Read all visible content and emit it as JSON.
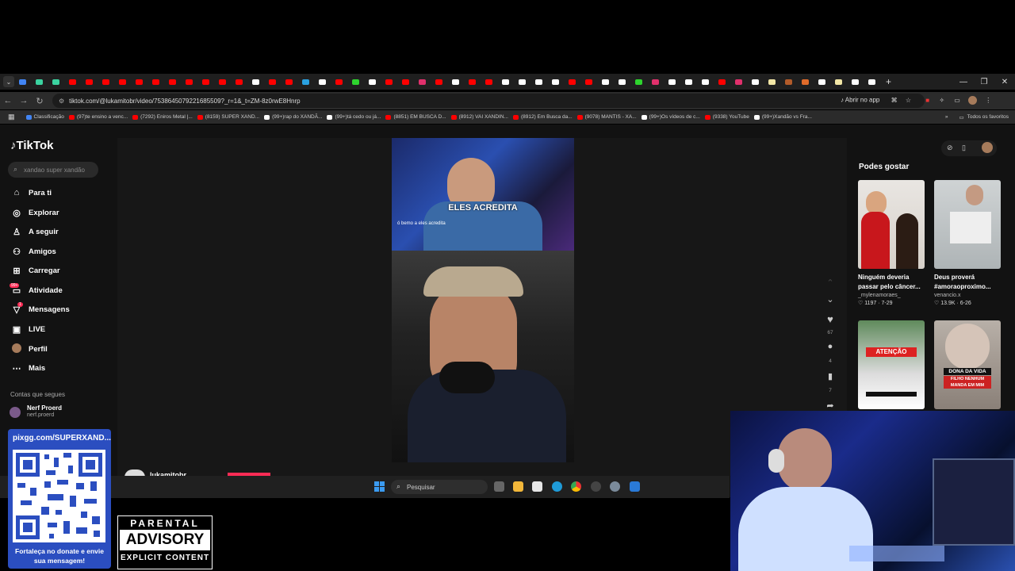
{
  "browser": {
    "url": "tiktok.com/@lukamitobr/video/7538645079221685509?_r=1&_t=ZM-8z0rwE8Hnrp",
    "open_app_label": "Abrir no app",
    "all_favorites_label": "Todos os favoritos",
    "bookmarks": [
      {
        "label": "Classificação",
        "color": "#4285f4"
      },
      {
        "label": "(97)te ensino a venc...",
        "color": "#ff0000"
      },
      {
        "label": "(7292) Eniros Metal |...",
        "color": "#ff0000"
      },
      {
        "label": "(8159) SUPER XAND...",
        "color": "#ff0000"
      },
      {
        "label": "(99+)rap do XANDÃ...",
        "color": "#ffffff"
      },
      {
        "label": "(99+)tá cedo ou já...",
        "color": "#ffffff"
      },
      {
        "label": "(8851) EM BUSCA D...",
        "color": "#ff0000"
      },
      {
        "label": "(8912) VAI XANDIN...",
        "color": "#ff0000"
      },
      {
        "label": "(8912) Em Busca da...",
        "color": "#ff0000"
      },
      {
        "label": "(9078) MANTIS - XA...",
        "color": "#ff0000"
      },
      {
        "label": "(99+)Os vídeos de c...",
        "color": "#ffffff"
      },
      {
        "label": "(9338) YouTube",
        "color": "#ff0000"
      },
      {
        "label": "(99+)Xandão vs Fra...",
        "color": "#ffffff"
      }
    ]
  },
  "tiktok": {
    "logo": "TikTok",
    "search_placeholder": "xandao super xandão",
    "nav": [
      {
        "label": "Para ti"
      },
      {
        "label": "Explorar"
      },
      {
        "label": "A seguir"
      },
      {
        "label": "Amigos"
      },
      {
        "label": "Carregar"
      },
      {
        "label": "Atividade"
      },
      {
        "label": "Mensagens"
      },
      {
        "label": "LIVE"
      },
      {
        "label": "Perfil"
      },
      {
        "label": "Mais"
      }
    ],
    "activity_badge": "99+",
    "messages_badge": "1",
    "following_heading": "Contas que segues",
    "following_account": {
      "name": "Nerf Proerd",
      "handle": "nerf.proerd"
    },
    "video": {
      "caption_big": "ELES ACREDITA",
      "caption_small": "ó bemo a eles acredita",
      "author": "lukamitobr"
    },
    "actions": {
      "likes": "67",
      "comments": "4",
      "saves": "7"
    },
    "suggestions_heading": "Podes gostar",
    "suggestions": [
      {
        "title": "Ninguém deveria passar pelo câncer...",
        "author": "_mylenamoraes_",
        "likes": "1197",
        "date": "7-29"
      },
      {
        "title": "Deus proverá #amoraoproximo...",
        "author": "venancio.x",
        "likes": "13.9K",
        "date": "6-26"
      },
      {
        "overlay": "ATENÇÃO"
      },
      {
        "overlay_line1": "DONA DA VIDA",
        "overlay_line2": "FILHO NENHUM MANDA EM MIM"
      }
    ]
  },
  "taskbar": {
    "search_label": "Pesquisar"
  },
  "stream_overlay": {
    "qr_url": "pixgg.com/SUPERXAND...",
    "qr_message": "Fortaleça no donate e envie sua mensagem!",
    "advisory_line1": "PARENTAL",
    "advisory_line2": "ADVISORY",
    "advisory_line3": "EXPLICIT CONTENT"
  },
  "colors": {
    "accent": "#fe2c55",
    "qr_panel": "#2b4ec0"
  }
}
